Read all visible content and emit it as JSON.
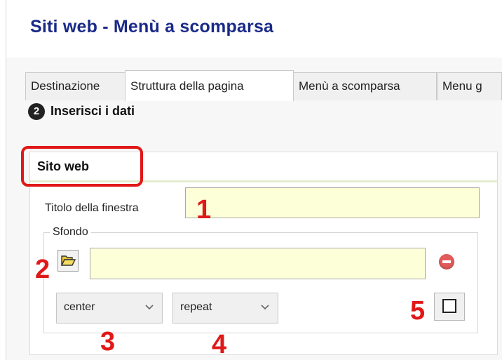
{
  "window": {
    "title": "Siti web - Menù a scomparsa"
  },
  "tabs": [
    {
      "label": "Destinazione",
      "active": false
    },
    {
      "label": "Struttura della pagina",
      "active": true
    },
    {
      "label": "Menù a scomparsa",
      "active": false
    },
    {
      "label": "Menu g",
      "active": false
    }
  ],
  "step": {
    "number": "2",
    "label": "Inserisci i dati"
  },
  "section": {
    "title": "Sito web",
    "window_title_label": "Titolo della finestra",
    "window_title_value": "",
    "background_legend": "Sfondo",
    "background_value": "",
    "position_select": "center",
    "repeat_select": "repeat",
    "checkbox_checked": false
  },
  "callouts": [
    "1",
    "2",
    "3",
    "4",
    "5"
  ],
  "colors": {
    "title": "#1a2a88",
    "callout": "#e01818",
    "field_bg": "#fcffd8",
    "remove": "#e35b5b"
  },
  "icons": {
    "folder": "folder-open-icon",
    "remove": "minus-circle-icon",
    "dropdown": "chevron-down-icon"
  }
}
